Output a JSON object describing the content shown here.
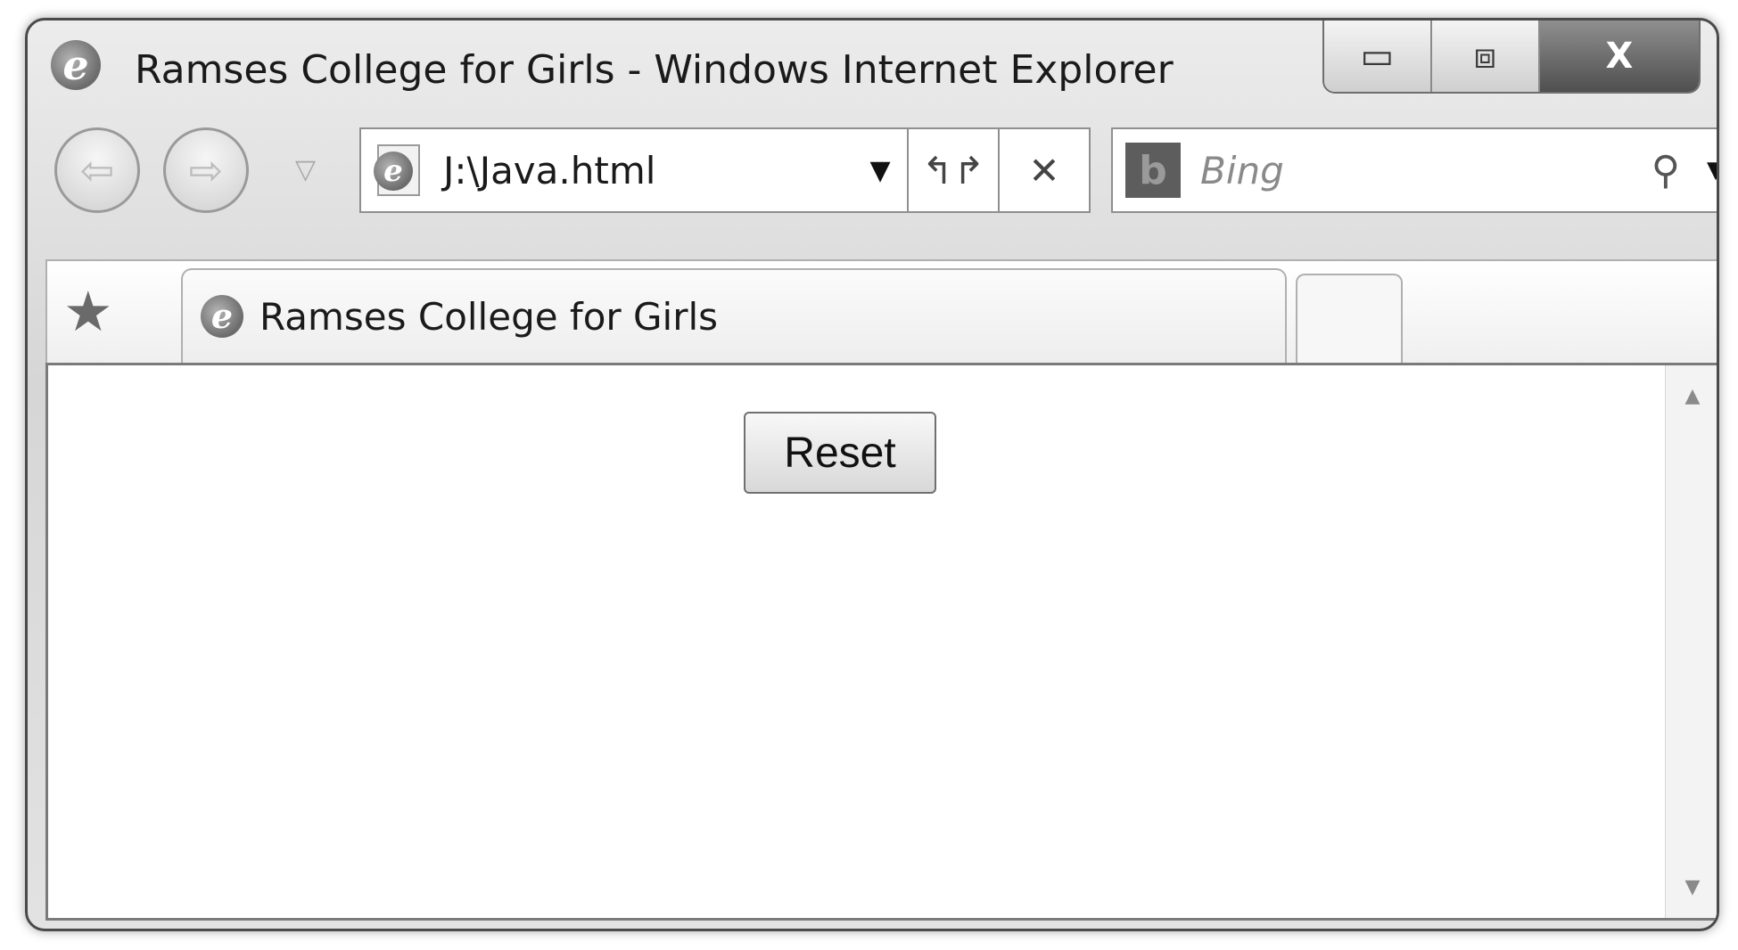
{
  "window": {
    "title": "Ramses College for Girls - Windows Internet Explorer",
    "controls": {
      "minimize": "▭",
      "maximize": "⧈",
      "close": "X"
    }
  },
  "navigation": {
    "back_icon": "arrow-left-icon",
    "forward_icon": "arrow-right-icon",
    "history_dropdown": "▽",
    "address_value": "J:\\Java.html",
    "address_dropdown": "▼",
    "refresh_symbol": "↰↱",
    "stop_symbol": "✕"
  },
  "search": {
    "provider": "Bing",
    "placeholder": "Bing",
    "logo_text": "b",
    "search_symbol": "⚲",
    "dropdown": "▼"
  },
  "tabs": {
    "favorites_symbol": "★",
    "active_tab_label": "Ramses College for Girls"
  },
  "page": {
    "reset_button_label": "Reset"
  },
  "scrollbar": {
    "up": "▲",
    "down": "▼"
  }
}
